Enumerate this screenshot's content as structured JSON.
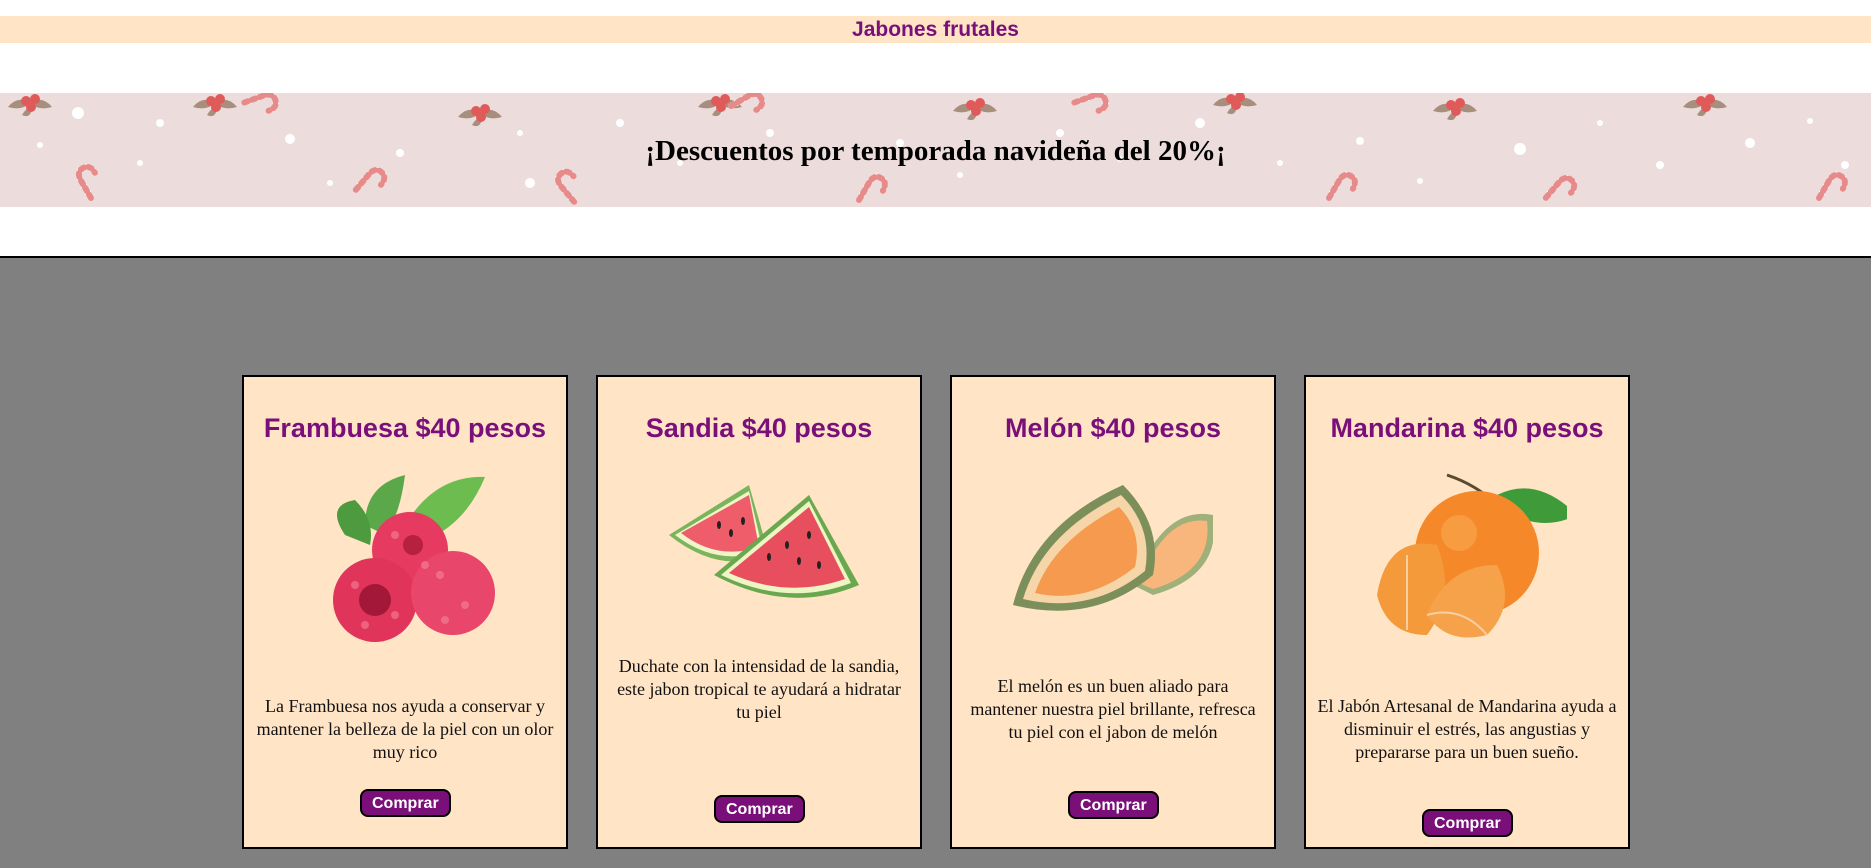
{
  "header": {
    "title": "Jabones frutales"
  },
  "banner": {
    "text": "¡Descuentos por temporada navideña del 20%¡"
  },
  "products": [
    {
      "title": "Frambuesa $40 pesos",
      "image": "raspberry-image",
      "description": "La Frambuesa nos ayuda a conservar y mantener la belleza de la piel con un olor muy rico",
      "button": "Comprar"
    },
    {
      "title": "Sandia $40 pesos",
      "image": "watermelon-image",
      "description": "Duchate con la intensidad de la sandia, este jabon tropical te ayudará a hidratar tu piel",
      "button": "Comprar"
    },
    {
      "title": "Melón $40 pesos",
      "image": "melon-image",
      "description": "El melón es un buen aliado para mantener nuestra piel brillante, refresca tu piel con el jabon de melón",
      "button": "Comprar"
    },
    {
      "title": "Mandarina $40 pesos",
      "image": "tangerine-image",
      "description": "El Jabón Artesanal de Mandarina ayuda a disminuir el estrés, las angustias y prepararse para un buen sueño.",
      "button": "Comprar"
    }
  ],
  "colors": {
    "header_bg": "#ffe4c6",
    "accent": "#7a0f7a",
    "banner_bg": "#ecdcdc",
    "section_bg": "#808080",
    "card_bg": "#ffe4c6"
  }
}
